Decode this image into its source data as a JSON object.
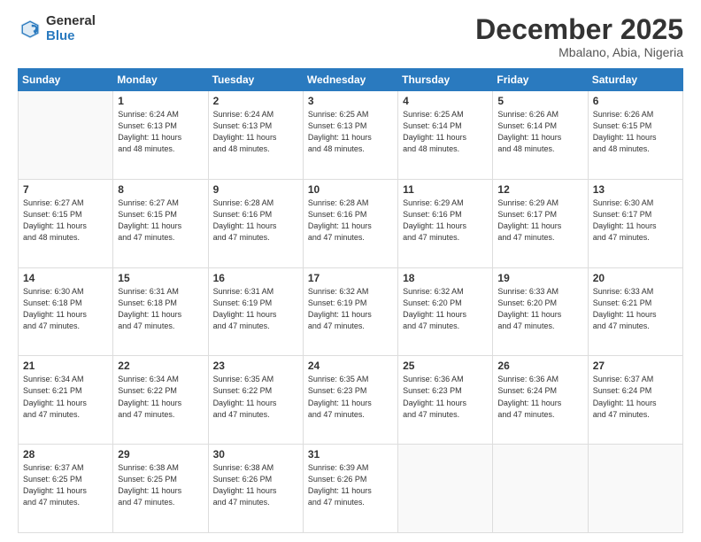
{
  "logo": {
    "general": "General",
    "blue": "Blue"
  },
  "title": {
    "month_year": "December 2025",
    "location": "Mbalano, Abia, Nigeria"
  },
  "header_days": [
    "Sunday",
    "Monday",
    "Tuesday",
    "Wednesday",
    "Thursday",
    "Friday",
    "Saturday"
  ],
  "weeks": [
    [
      {
        "day": "",
        "info": ""
      },
      {
        "day": "1",
        "info": "Sunrise: 6:24 AM\nSunset: 6:13 PM\nDaylight: 11 hours\nand 48 minutes."
      },
      {
        "day": "2",
        "info": "Sunrise: 6:24 AM\nSunset: 6:13 PM\nDaylight: 11 hours\nand 48 minutes."
      },
      {
        "day": "3",
        "info": "Sunrise: 6:25 AM\nSunset: 6:13 PM\nDaylight: 11 hours\nand 48 minutes."
      },
      {
        "day": "4",
        "info": "Sunrise: 6:25 AM\nSunset: 6:14 PM\nDaylight: 11 hours\nand 48 minutes."
      },
      {
        "day": "5",
        "info": "Sunrise: 6:26 AM\nSunset: 6:14 PM\nDaylight: 11 hours\nand 48 minutes."
      },
      {
        "day": "6",
        "info": "Sunrise: 6:26 AM\nSunset: 6:15 PM\nDaylight: 11 hours\nand 48 minutes."
      }
    ],
    [
      {
        "day": "7",
        "info": "Sunrise: 6:27 AM\nSunset: 6:15 PM\nDaylight: 11 hours\nand 48 minutes."
      },
      {
        "day": "8",
        "info": "Sunrise: 6:27 AM\nSunset: 6:15 PM\nDaylight: 11 hours\nand 47 minutes."
      },
      {
        "day": "9",
        "info": "Sunrise: 6:28 AM\nSunset: 6:16 PM\nDaylight: 11 hours\nand 47 minutes."
      },
      {
        "day": "10",
        "info": "Sunrise: 6:28 AM\nSunset: 6:16 PM\nDaylight: 11 hours\nand 47 minutes."
      },
      {
        "day": "11",
        "info": "Sunrise: 6:29 AM\nSunset: 6:16 PM\nDaylight: 11 hours\nand 47 minutes."
      },
      {
        "day": "12",
        "info": "Sunrise: 6:29 AM\nSunset: 6:17 PM\nDaylight: 11 hours\nand 47 minutes."
      },
      {
        "day": "13",
        "info": "Sunrise: 6:30 AM\nSunset: 6:17 PM\nDaylight: 11 hours\nand 47 minutes."
      }
    ],
    [
      {
        "day": "14",
        "info": "Sunrise: 6:30 AM\nSunset: 6:18 PM\nDaylight: 11 hours\nand 47 minutes."
      },
      {
        "day": "15",
        "info": "Sunrise: 6:31 AM\nSunset: 6:18 PM\nDaylight: 11 hours\nand 47 minutes."
      },
      {
        "day": "16",
        "info": "Sunrise: 6:31 AM\nSunset: 6:19 PM\nDaylight: 11 hours\nand 47 minutes."
      },
      {
        "day": "17",
        "info": "Sunrise: 6:32 AM\nSunset: 6:19 PM\nDaylight: 11 hours\nand 47 minutes."
      },
      {
        "day": "18",
        "info": "Sunrise: 6:32 AM\nSunset: 6:20 PM\nDaylight: 11 hours\nand 47 minutes."
      },
      {
        "day": "19",
        "info": "Sunrise: 6:33 AM\nSunset: 6:20 PM\nDaylight: 11 hours\nand 47 minutes."
      },
      {
        "day": "20",
        "info": "Sunrise: 6:33 AM\nSunset: 6:21 PM\nDaylight: 11 hours\nand 47 minutes."
      }
    ],
    [
      {
        "day": "21",
        "info": "Sunrise: 6:34 AM\nSunset: 6:21 PM\nDaylight: 11 hours\nand 47 minutes."
      },
      {
        "day": "22",
        "info": "Sunrise: 6:34 AM\nSunset: 6:22 PM\nDaylight: 11 hours\nand 47 minutes."
      },
      {
        "day": "23",
        "info": "Sunrise: 6:35 AM\nSunset: 6:22 PM\nDaylight: 11 hours\nand 47 minutes."
      },
      {
        "day": "24",
        "info": "Sunrise: 6:35 AM\nSunset: 6:23 PM\nDaylight: 11 hours\nand 47 minutes."
      },
      {
        "day": "25",
        "info": "Sunrise: 6:36 AM\nSunset: 6:23 PM\nDaylight: 11 hours\nand 47 minutes."
      },
      {
        "day": "26",
        "info": "Sunrise: 6:36 AM\nSunset: 6:24 PM\nDaylight: 11 hours\nand 47 minutes."
      },
      {
        "day": "27",
        "info": "Sunrise: 6:37 AM\nSunset: 6:24 PM\nDaylight: 11 hours\nand 47 minutes."
      }
    ],
    [
      {
        "day": "28",
        "info": "Sunrise: 6:37 AM\nSunset: 6:25 PM\nDaylight: 11 hours\nand 47 minutes."
      },
      {
        "day": "29",
        "info": "Sunrise: 6:38 AM\nSunset: 6:25 PM\nDaylight: 11 hours\nand 47 minutes."
      },
      {
        "day": "30",
        "info": "Sunrise: 6:38 AM\nSunset: 6:26 PM\nDaylight: 11 hours\nand 47 minutes."
      },
      {
        "day": "31",
        "info": "Sunrise: 6:39 AM\nSunset: 6:26 PM\nDaylight: 11 hours\nand 47 minutes."
      },
      {
        "day": "",
        "info": ""
      },
      {
        "day": "",
        "info": ""
      },
      {
        "day": "",
        "info": ""
      }
    ]
  ]
}
